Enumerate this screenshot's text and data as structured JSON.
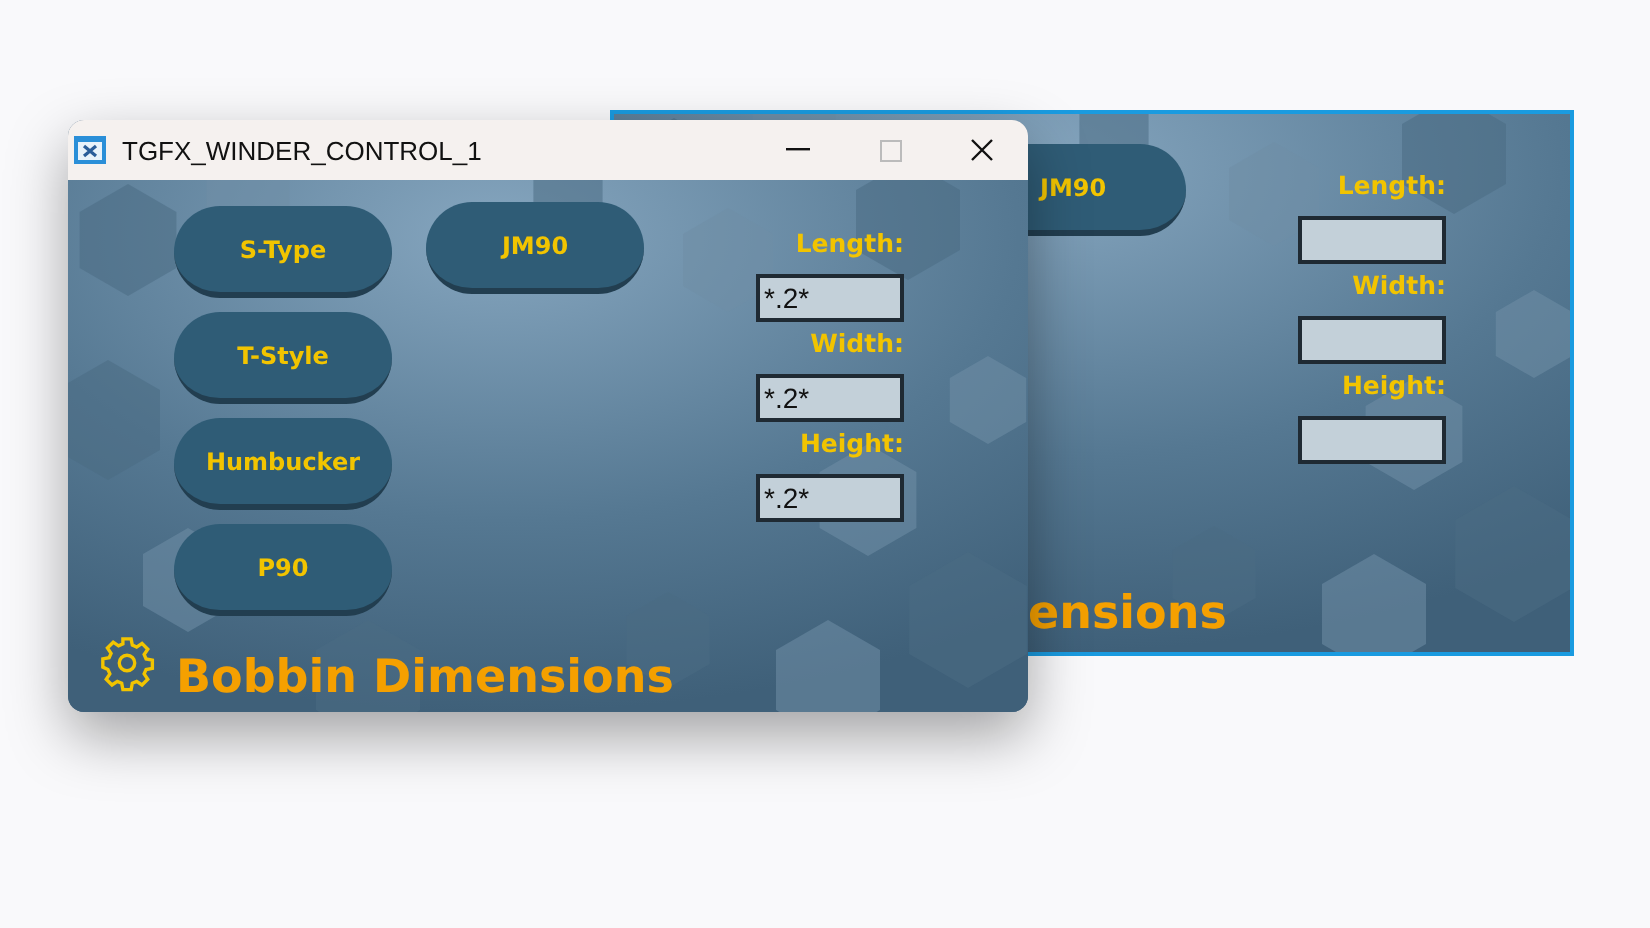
{
  "back_window": {
    "button": "JM90",
    "fields": [
      {
        "label": "Length:"
      },
      {
        "label": "Width:"
      },
      {
        "label": "Height:"
      }
    ],
    "title": "ensions"
  },
  "window": {
    "title": "TGFX_WINDER_CONTROL_1"
  },
  "buttons": [
    "S-Type",
    "T-Style",
    "Humbucker",
    "P90"
  ],
  "extra_button": "JM90",
  "fields": [
    {
      "label": "Length:",
      "value": "*.2*"
    },
    {
      "label": "Width:",
      "value": "*.2*"
    },
    {
      "label": "Height:",
      "value": "*.2*"
    }
  ],
  "title": "Bobbin Dimensions"
}
